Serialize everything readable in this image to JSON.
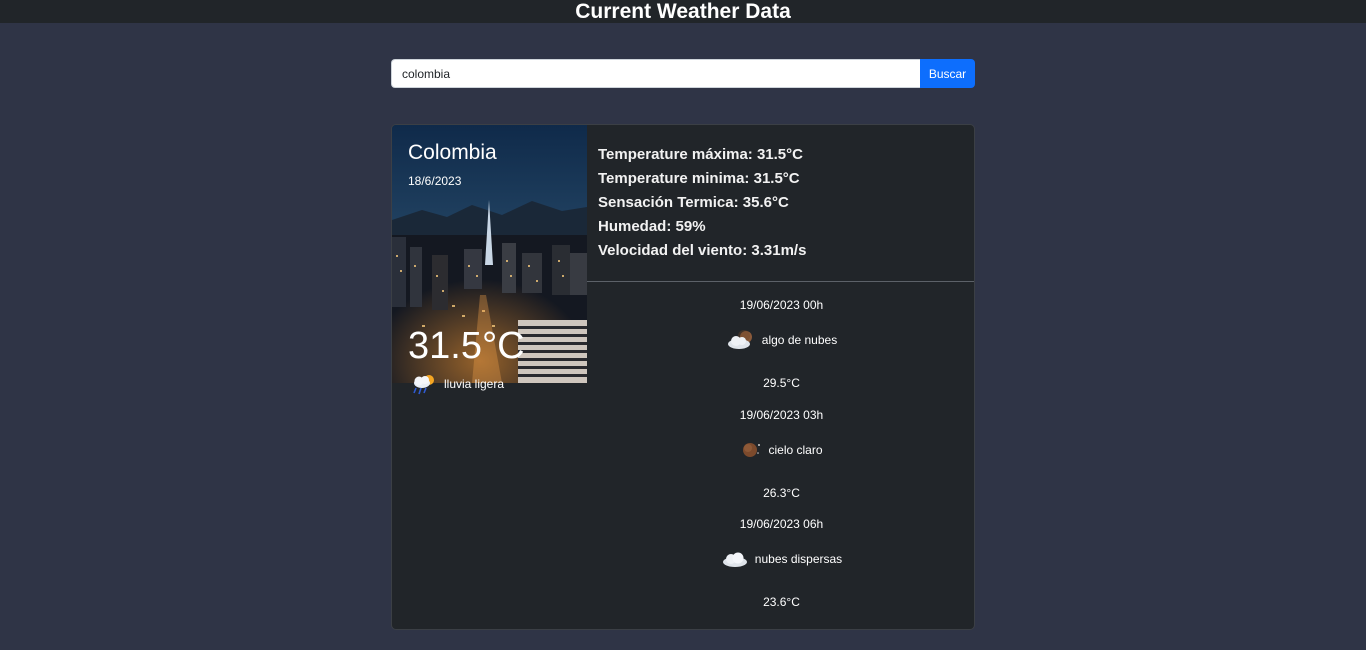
{
  "header": {
    "title": "Current Weather Data"
  },
  "search": {
    "value": "colombia",
    "placeholder": "",
    "button_label": "Buscar"
  },
  "current": {
    "city": "Colombia",
    "date": "18/6/2023",
    "temperature": "31.5°C",
    "description": "lluvia ligera",
    "icon": "rain-sun-icon"
  },
  "stats": {
    "max_temp": "Temperature máxima: 31.5°C",
    "min_temp": "Temperature minima: 31.5°C",
    "feels_like": "Sensación Termica: 35.6°C",
    "humidity": "Humedad: 59%",
    "wind": "Velocidad del viento: 3.31m/s"
  },
  "forecast": [
    {
      "time": "19/06/2023 00h",
      "icon": "partly-cloudy-night-icon",
      "description": "algo de nubes",
      "temp": "29.5°C"
    },
    {
      "time": "19/06/2023 03h",
      "icon": "clear-night-icon",
      "description": "cielo claro",
      "temp": "26.3°C"
    },
    {
      "time": "19/06/2023 06h",
      "icon": "cloud-icon",
      "description": "nubes dispersas",
      "temp": "23.6°C"
    }
  ]
}
